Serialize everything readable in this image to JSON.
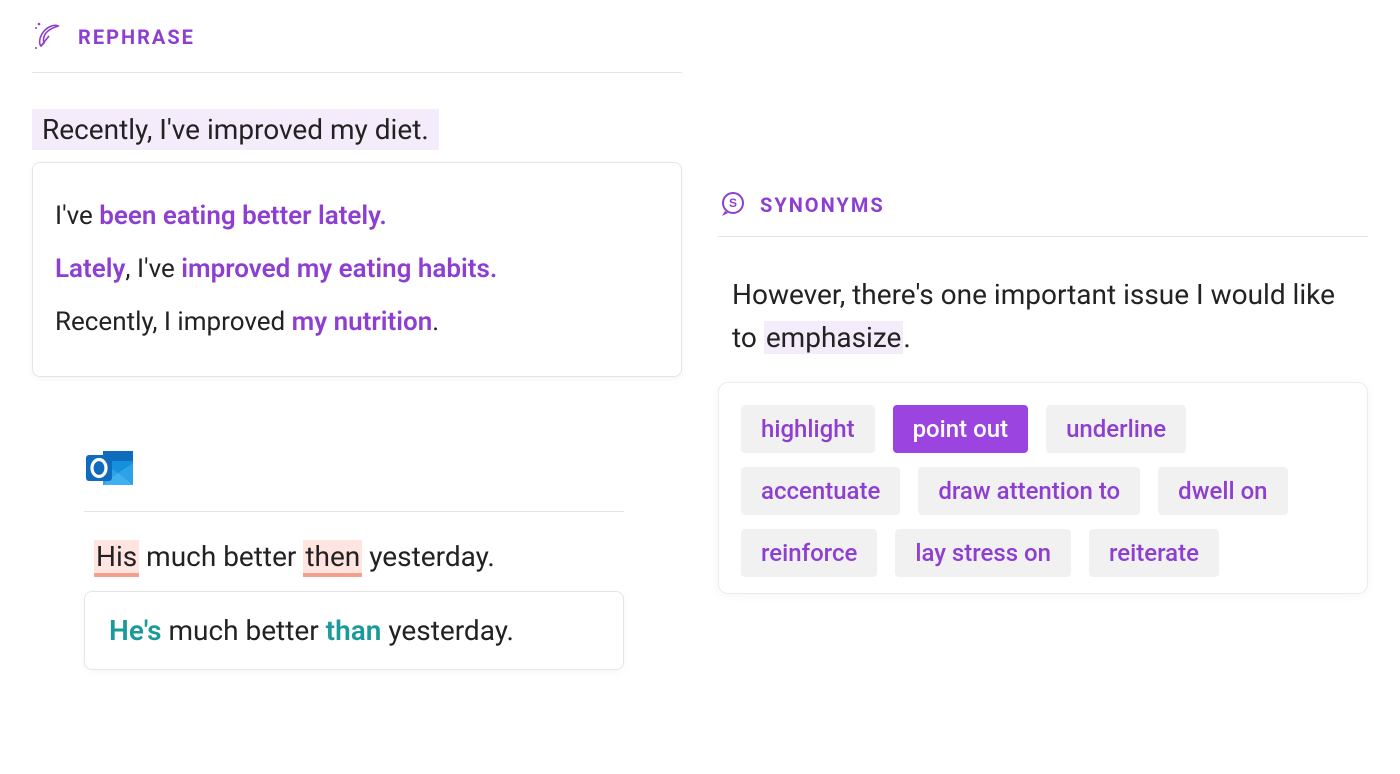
{
  "rephrase": {
    "title": "REPHRASE",
    "source": "Recently, I've improved my diet.",
    "suggestions": [
      {
        "parts": [
          {
            "t": "I've ",
            "hl": false
          },
          {
            "t": "been eating better lately.",
            "hl": true
          }
        ]
      },
      {
        "parts": [
          {
            "t": "Lately",
            "hl": true
          },
          {
            "t": ", I've ",
            "hl": false
          },
          {
            "t": "improved my eating habits.",
            "hl": true
          }
        ]
      },
      {
        "parts": [
          {
            "t": "Recently, I improved ",
            "hl": false
          },
          {
            "t": "my nutrition",
            "hl": true
          },
          {
            "t": ".",
            "hl": false
          }
        ]
      }
    ]
  },
  "grammar": {
    "source_parts": [
      {
        "t": "His",
        "err": true
      },
      {
        "t": " much better ",
        "err": false
      },
      {
        "t": "then",
        "err": true
      },
      {
        "t": " yesterday.",
        "err": false
      }
    ],
    "fix_parts": [
      {
        "t": "He's",
        "teal": true
      },
      {
        "t": " much better ",
        "teal": false
      },
      {
        "t": "than",
        "teal": true
      },
      {
        "t": " yesterday.",
        "teal": false
      }
    ]
  },
  "synonyms": {
    "title": "SYNONYMS",
    "source_pre": "However, there's one important issue I would like to ",
    "source_target": "emphasize",
    "source_post": ".",
    "chips": [
      {
        "label": "highlight",
        "selected": false
      },
      {
        "label": "point out",
        "selected": true
      },
      {
        "label": "underline",
        "selected": false
      },
      {
        "label": "accentuate",
        "selected": false
      },
      {
        "label": "draw attention to",
        "selected": false
      },
      {
        "label": "dwell on",
        "selected": false
      },
      {
        "label": "reinforce",
        "selected": false
      },
      {
        "label": "lay stress on",
        "selected": false
      },
      {
        "label": "reiterate",
        "selected": false
      }
    ]
  }
}
